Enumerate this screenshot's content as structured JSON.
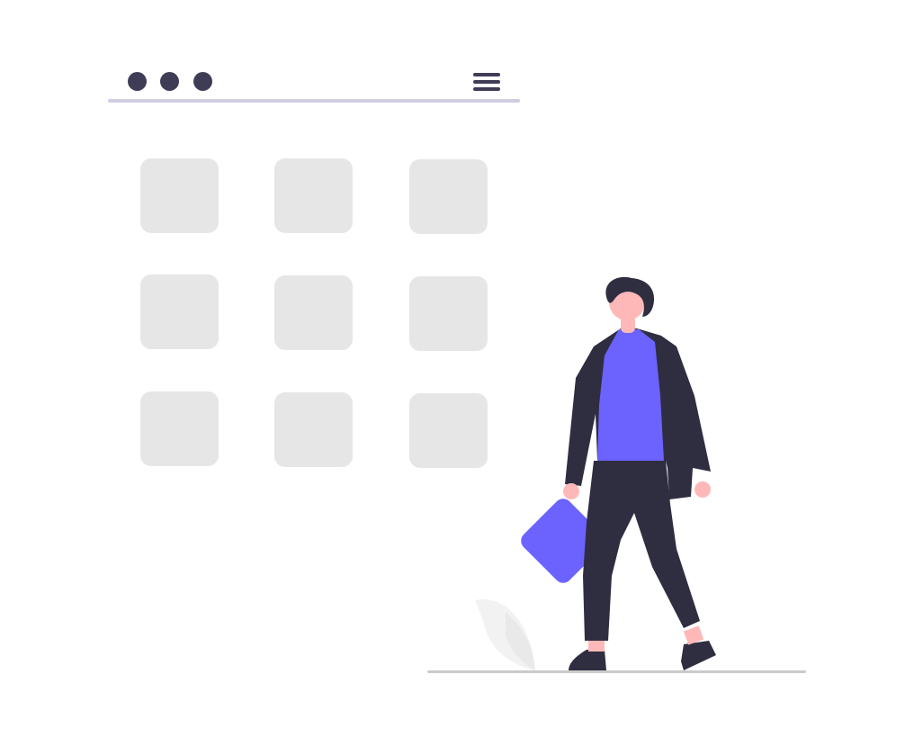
{
  "window": {
    "dots": [
      {
        "name": "window-dot-1",
        "color": "#3f3d56"
      },
      {
        "name": "window-dot-2",
        "color": "#3f3d56"
      },
      {
        "name": "window-dot-3",
        "color": "#3f3d56"
      }
    ],
    "line_color": "#d0cde1",
    "menu_icon": "hamburger-menu-icon",
    "menu_color": "#3f3d56"
  },
  "grid": {
    "tile_color": "#e6e6e6",
    "rows": 3,
    "cols": 3
  },
  "illustration": {
    "person": "walking-person-illustration",
    "bag": "briefcase-illustration",
    "plant": "leaf-plant-illustration",
    "colors": {
      "accent": "#6c63ff",
      "dark": "#2f2e41",
      "skin": "#ffb8b8",
      "leaf": "#f2f2f2",
      "ground": "#cacaca"
    }
  }
}
